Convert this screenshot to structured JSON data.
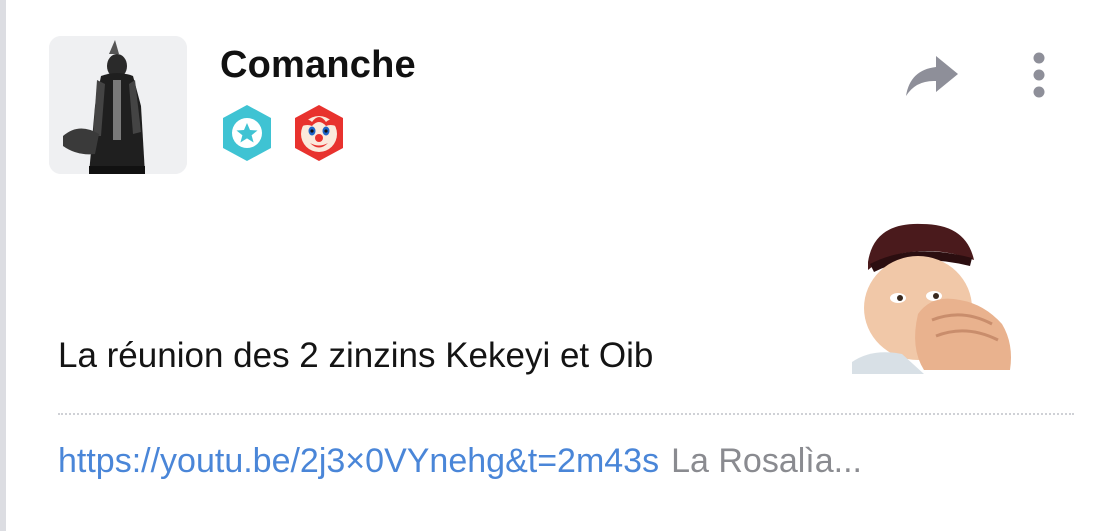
{
  "post": {
    "author": "Comanche",
    "badges": [
      {
        "icon": "star-badge-icon",
        "color": "#3fc3d3"
      },
      {
        "icon": "clown-face-badge-icon",
        "color": "#e8322e"
      }
    ],
    "text": "La réunion des 2 zinzins Kekeyi et Oib",
    "link": {
      "url": "https://youtu.be/2j3×0VYnehg&t=2m43s",
      "title": "La Rosalìa..."
    }
  },
  "actions": {
    "share_icon": "share-arrow-icon",
    "more_icon": "vertical-dots-icon"
  },
  "colors": {
    "link": "#4a86d8",
    "muted": "#8a8b90",
    "icon": "#8e8f99"
  }
}
